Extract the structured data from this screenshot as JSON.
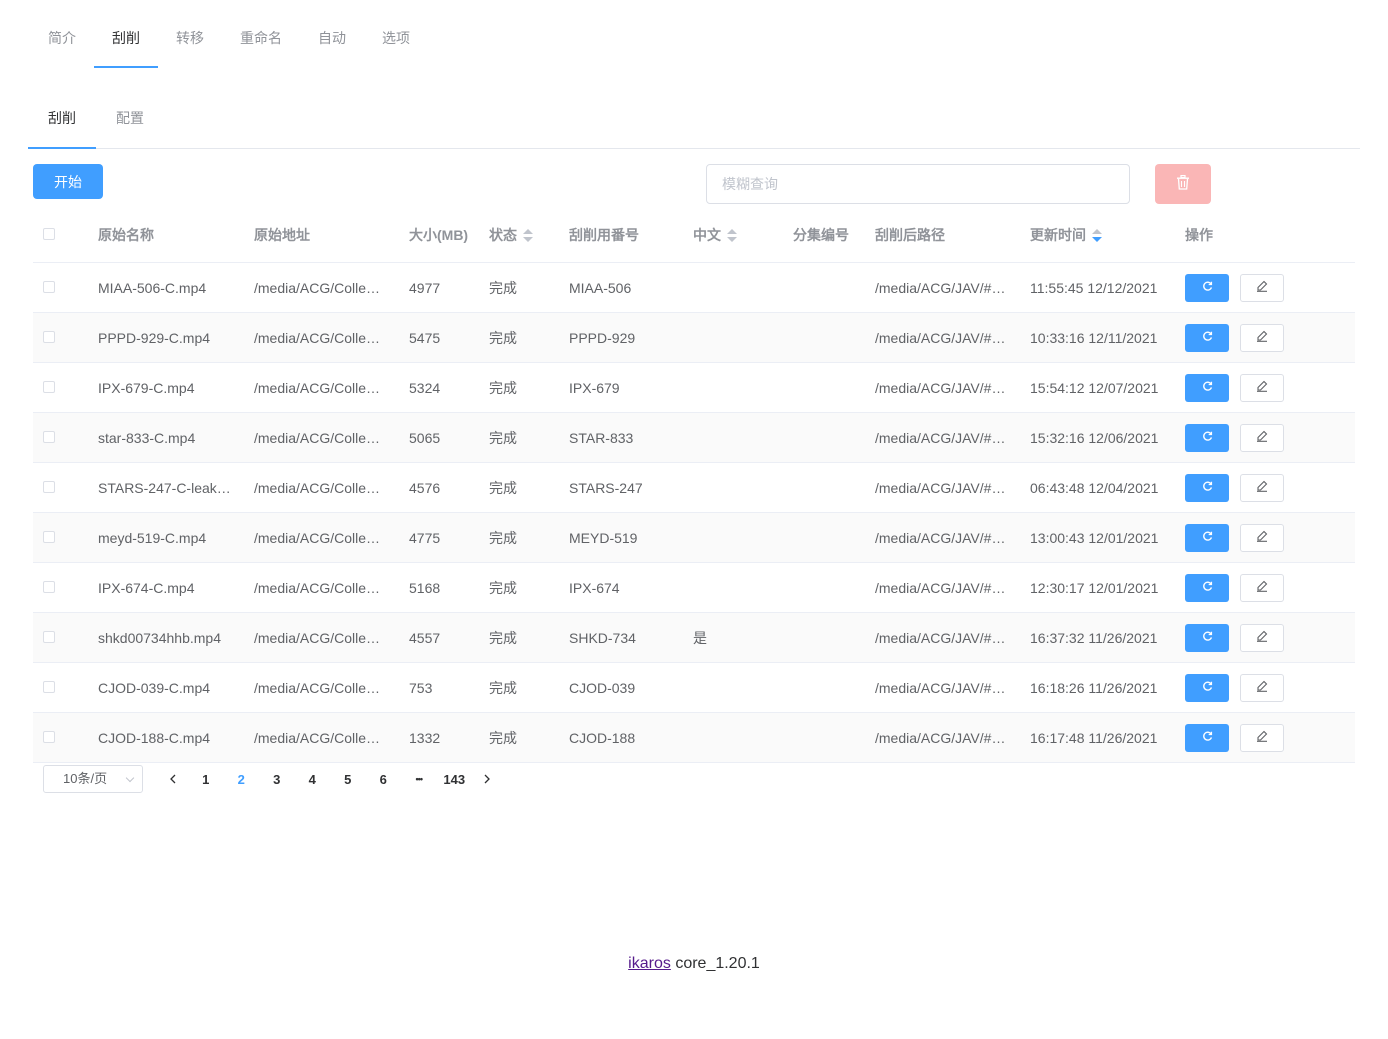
{
  "top_tabs": [
    {
      "label": "简介",
      "active": false
    },
    {
      "label": "刮削",
      "active": true
    },
    {
      "label": "转移",
      "active": false
    },
    {
      "label": "重命名",
      "active": false
    },
    {
      "label": "自动",
      "active": false
    },
    {
      "label": "选项",
      "active": false
    }
  ],
  "sub_tabs": [
    {
      "label": "刮削",
      "active": true
    },
    {
      "label": "配置",
      "active": false
    }
  ],
  "toolbar": {
    "start_label": "开始",
    "search_placeholder": "模糊查询",
    "search_value": "",
    "delete_icon": "trash-icon"
  },
  "table": {
    "headers": [
      "原始名称",
      "原始地址",
      "大小(MB)",
      "状态",
      "刮削用番号",
      "中文",
      "分集编号",
      "刮削后路径",
      "更新时间",
      "操作"
    ],
    "sortable": {
      "状态": "none",
      "中文": "none",
      "更新时间": "descending"
    },
    "rows": [
      {
        "name": "MIAA-506-C.mp4",
        "src": "/media/ACG/Colle…",
        "size": "4977",
        "status": "完成",
        "number": "MIAA-506",
        "cn": "",
        "ep": "",
        "dest": "/media/ACG/JAV/#…",
        "time": "11:55:45 12/12/2021"
      },
      {
        "name": "PPPD-929-C.mp4",
        "src": "/media/ACG/Colle…",
        "size": "5475",
        "status": "完成",
        "number": "PPPD-929",
        "cn": "",
        "ep": "",
        "dest": "/media/ACG/JAV/#…",
        "time": "10:33:16 12/11/2021"
      },
      {
        "name": "IPX-679-C.mp4",
        "src": "/media/ACG/Colle…",
        "size": "5324",
        "status": "完成",
        "number": "IPX-679",
        "cn": "",
        "ep": "",
        "dest": "/media/ACG/JAV/#…",
        "time": "15:54:12 12/07/2021"
      },
      {
        "name": "star-833-C.mp4",
        "src": "/media/ACG/Colle…",
        "size": "5065",
        "status": "完成",
        "number": "STAR-833",
        "cn": "",
        "ep": "",
        "dest": "/media/ACG/JAV/#…",
        "time": "15:32:16 12/06/2021"
      },
      {
        "name": "STARS-247-C-leak…",
        "src": "/media/ACG/Colle…",
        "size": "4576",
        "status": "完成",
        "number": "STARS-247",
        "cn": "",
        "ep": "",
        "dest": "/media/ACG/JAV/#…",
        "time": "06:43:48 12/04/2021"
      },
      {
        "name": "meyd-519-C.mp4",
        "src": "/media/ACG/Colle…",
        "size": "4775",
        "status": "完成",
        "number": "MEYD-519",
        "cn": "",
        "ep": "",
        "dest": "/media/ACG/JAV/#…",
        "time": "13:00:43 12/01/2021"
      },
      {
        "name": "IPX-674-C.mp4",
        "src": "/media/ACG/Colle…",
        "size": "5168",
        "status": "完成",
        "number": "IPX-674",
        "cn": "",
        "ep": "",
        "dest": "/media/ACG/JAV/#…",
        "time": "12:30:17 12/01/2021"
      },
      {
        "name": "shkd00734hhb.mp4",
        "src": "/media/ACG/Colle…",
        "size": "4557",
        "status": "完成",
        "number": "SHKD-734",
        "cn": "是",
        "ep": "",
        "dest": "/media/ACG/JAV/#…",
        "time": "16:37:32 11/26/2021"
      },
      {
        "name": "CJOD-039-C.mp4",
        "src": "/media/ACG/Colle…",
        "size": "753",
        "status": "完成",
        "number": "CJOD-039",
        "cn": "",
        "ep": "",
        "dest": "/media/ACG/JAV/#…",
        "time": "16:18:26 11/26/2021"
      },
      {
        "name": "CJOD-188-C.mp4",
        "src": "/media/ACG/Colle…",
        "size": "1332",
        "status": "完成",
        "number": "CJOD-188",
        "cn": "",
        "ep": "",
        "dest": "/media/ACG/JAV/#…",
        "time": "16:17:48 11/26/2021"
      }
    ]
  },
  "pagination": {
    "page_size_label": "10条/页",
    "pages": [
      "1",
      "2",
      "3",
      "4",
      "5",
      "6"
    ],
    "current": "2",
    "ellipsis": "•••",
    "last_page": "143"
  },
  "footer": {
    "link_text": "ikaros",
    "version": "core_1.20.1"
  },
  "colors": {
    "primary": "#409eff",
    "danger_disabled": "#fab6b6",
    "border": "#ebeef5"
  }
}
